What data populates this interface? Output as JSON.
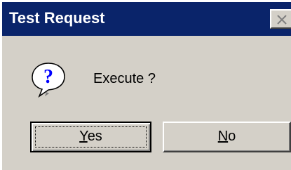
{
  "window": {
    "title": "Test Request",
    "close_label": "×"
  },
  "dialog": {
    "icon": "question-icon",
    "message": "Execute ?"
  },
  "buttons": {
    "yes": {
      "accel": "Y",
      "rest": "es"
    },
    "no": {
      "accel": "N",
      "rest": "o"
    }
  },
  "colors": {
    "titlebar": "#0a246a",
    "face": "#d4d0c8",
    "icon_glyph": "#0000ff"
  }
}
